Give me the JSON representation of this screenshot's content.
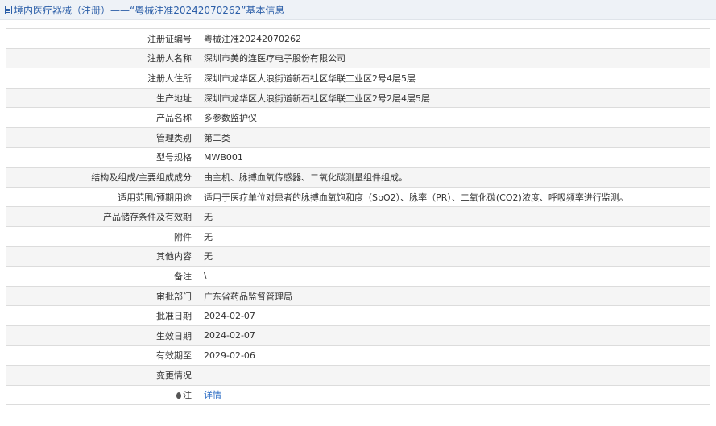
{
  "header": {
    "title": "境内医疗器械（注册）——“粤械注准20242070262”基本信息"
  },
  "rows": [
    {
      "label": "注册证编号",
      "value": "粤械注准20242070262"
    },
    {
      "label": "注册人名称",
      "value": "深圳市美的连医疗电子股份有限公司"
    },
    {
      "label": "注册人住所",
      "value": "深圳市龙华区大浪街道新石社区华联工业区2号4层5层"
    },
    {
      "label": "生产地址",
      "value": "深圳市龙华区大浪街道新石社区华联工业区2号2层4层5层"
    },
    {
      "label": "产品名称",
      "value": "多参数监护仪"
    },
    {
      "label": "管理类别",
      "value": "第二类"
    },
    {
      "label": "型号规格",
      "value": "MWB001"
    },
    {
      "label": "结构及组成/主要组成成分",
      "value": "由主机、脉搏血氧传感器、二氧化碳测量组件组成。"
    },
    {
      "label": "适用范围/预期用途",
      "value": "适用于医疗单位对患者的脉搏血氧饱和度（SpO2）、脉率（PR）、二氧化碳(CO2)浓度、呼吸频率进行监测。"
    },
    {
      "label": "产品储存条件及有效期",
      "value": "无"
    },
    {
      "label": "附件",
      "value": "无"
    },
    {
      "label": "其他内容",
      "value": "无"
    },
    {
      "label": "备注",
      "value": "\\"
    },
    {
      "label": "审批部门",
      "value": "广东省药品监督管理局"
    },
    {
      "label": "批准日期",
      "value": "2024-02-07"
    },
    {
      "label": "生效日期",
      "value": "2024-02-07"
    },
    {
      "label": "有效期至",
      "value": "2029-02-06"
    },
    {
      "label": "变更情况",
      "value": ""
    }
  ],
  "note_row": {
    "label": "注",
    "icon": "lightbulb-icon",
    "link_text": "详情"
  },
  "colors": {
    "title_text": "#2b5ea8",
    "link": "#2b6cc4",
    "border": "#dcdcdc"
  }
}
